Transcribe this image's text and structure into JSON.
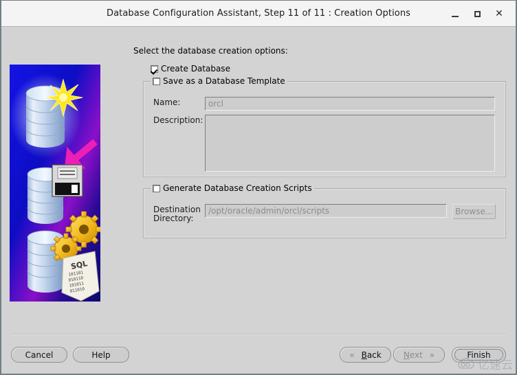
{
  "window": {
    "title": "Database Configuration Assistant, Step 11 of 11 : Creation Options",
    "controls": {
      "minimize": "minimize-icon",
      "maximize": "maximize-icon",
      "close": "close-icon"
    }
  },
  "main": {
    "intro": "Select the database creation options:",
    "create_database": {
      "label": "Create Database",
      "checked": true
    },
    "template_group": {
      "label": "Save as a Database Template",
      "checked": false,
      "name_label": "Name:",
      "name_value": "orcl",
      "description_label": "Description:",
      "description_value": ""
    },
    "scripts_group": {
      "label": "Generate Database Creation Scripts",
      "checked": false,
      "destination_label_line1": "Destination",
      "destination_label_line2": "Directory:",
      "destination_value": "/opt/oracle/admin/orcl/scripts",
      "browse_label": "Browse..."
    }
  },
  "footer": {
    "cancel": "Cancel",
    "help": "Help",
    "back_mnemonic": "B",
    "back_rest": "ack",
    "back_chevron": "«",
    "next_mnemonic": "N",
    "next_rest": "ext",
    "next_chevron": "»",
    "finish": "Finish"
  },
  "watermark": {
    "text": "亿速云",
    "logo": "cloud-logo-icon"
  },
  "colors": {
    "window_bg": "#d3d3d3",
    "titlebar_bg": "#f4f4f4",
    "art_blue": "#0b0bd2",
    "art_magenta": "#ee1fb6",
    "art_star": "#ffe81a",
    "field_disabled_text": "#8c8c8c"
  }
}
